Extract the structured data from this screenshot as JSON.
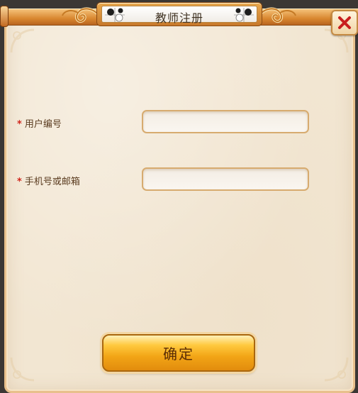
{
  "dialog": {
    "title": "教师注册",
    "close_icon": "close-x-icon"
  },
  "form": {
    "fields": [
      {
        "required_mark": "*",
        "label": "用户编号",
        "value": "",
        "placeholder": ""
      },
      {
        "required_mark": "*",
        "label": "手机号或邮箱",
        "value": "",
        "placeholder": ""
      }
    ]
  },
  "actions": {
    "confirm_label": "确定"
  },
  "colors": {
    "accent": "#e28c0d",
    "required": "#d0261b",
    "panel": "#f2e6d2",
    "close_x": "#c81e1e"
  }
}
